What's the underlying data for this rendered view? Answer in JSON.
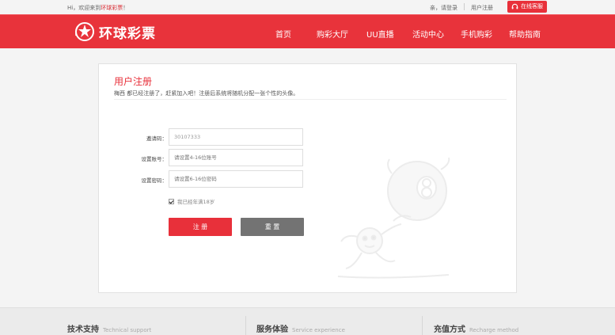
{
  "topbar": {
    "greeting_prefix": "Hi，欢迎来到",
    "greeting_brand": "环球彩票",
    "greeting_suffix": "！",
    "login": "亲，请登录",
    "register": "用户注册",
    "service": "在线客服"
  },
  "header": {
    "logo_text": "环球彩票",
    "nav": [
      "首页",
      "购彩大厅",
      "UU直播",
      "活动中心",
      "手机购彩",
      "帮助指南"
    ]
  },
  "form": {
    "title": "用户注册",
    "note": "梅西 都已经注册了，赶紧加入吧！注册后系统将随机分配一张个性的头像。",
    "invite_label": "邀请码：",
    "invite_value": "30107333",
    "account_label": "设置账号：",
    "account_placeholder": "请设置4-16位账号",
    "password_label": "设置密码：",
    "password_placeholder": "请设置6-16位密码",
    "agree_text": "我已经年满18岁",
    "agree_checked": true,
    "register_button": "注 册",
    "reset_button": "重 置"
  },
  "footer": {
    "columns": [
      {
        "cn": "技术支持",
        "en": "Technical support"
      },
      {
        "cn": "服务体验",
        "en": "Service experience"
      },
      {
        "cn": "充值方式",
        "en": "Recharge method"
      }
    ]
  },
  "colors": {
    "brand_red": "#e8333b",
    "reset_gray": "#737373"
  }
}
